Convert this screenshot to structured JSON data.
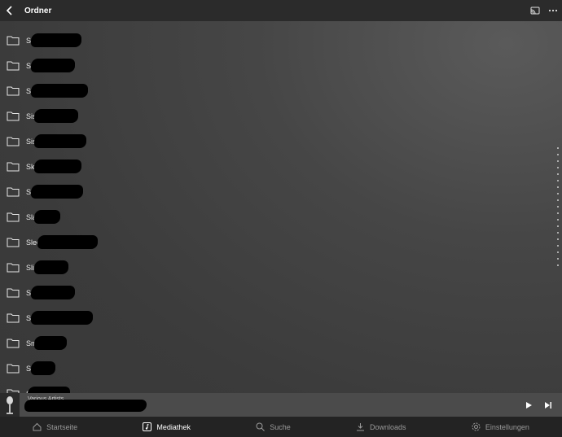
{
  "header": {
    "title": "Ordner",
    "back_icon": "chevron-left-icon",
    "cast_icon": "cast-icon",
    "more_icon": "more-horizontal-icon"
  },
  "folders": [
    {
      "label": "Si"
    },
    {
      "label": "Si"
    },
    {
      "label": "Si"
    },
    {
      "label": "Sis"
    },
    {
      "label": "Sis"
    },
    {
      "label": "Ske"
    },
    {
      "label": "Sk"
    },
    {
      "label": "Sla"
    },
    {
      "label": "Slee"
    },
    {
      "label": "Sli"
    },
    {
      "label": "Sm"
    },
    {
      "label": "Sm"
    },
    {
      "label": "Sme"
    },
    {
      "label": "Sn"
    },
    {
      "label": "S"
    }
  ],
  "mini_player": {
    "artist": "Various Artists"
  },
  "nav": {
    "items": [
      {
        "label": "Startseite",
        "icon": "home-icon",
        "active": false
      },
      {
        "label": "Mediathek",
        "icon": "music-note-icon",
        "active": true
      },
      {
        "label": "Suche",
        "icon": "search-icon",
        "active": false
      },
      {
        "label": "Downloads",
        "icon": "download-icon",
        "active": false
      },
      {
        "label": "Einstellungen",
        "icon": "gear-icon",
        "active": false
      }
    ]
  },
  "colors": {
    "header_bg": "#2b2b2b",
    "nav_bg": "#232323",
    "player_bg": "#4b4b4b",
    "active_text": "#ffffff",
    "inactive_text": "#9a9a9a"
  }
}
